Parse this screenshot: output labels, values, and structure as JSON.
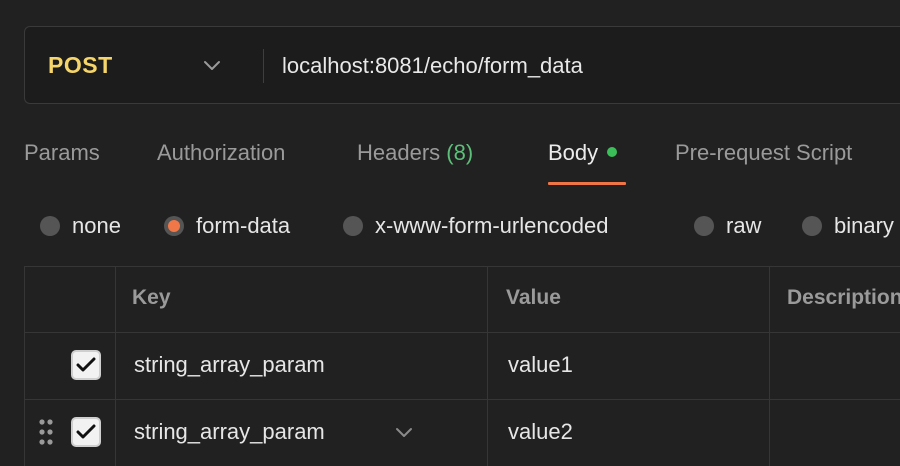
{
  "request": {
    "method": "POST",
    "url": "localhost:8081/echo/form_data"
  },
  "tabs": [
    {
      "label": "Params"
    },
    {
      "label": "Authorization"
    },
    {
      "label": "Headers",
      "count": "(8)"
    },
    {
      "label": "Body",
      "active": true
    },
    {
      "label": "Pre-request Script"
    }
  ],
  "body_types": [
    {
      "label": "none",
      "selected": false
    },
    {
      "label": "form-data",
      "selected": true
    },
    {
      "label": "x-www-form-urlencoded",
      "selected": false
    },
    {
      "label": "raw",
      "selected": false
    },
    {
      "label": "binary",
      "selected": false
    }
  ],
  "table": {
    "headers": {
      "key": "Key",
      "value": "Value",
      "description": "Description"
    },
    "rows": [
      {
        "checked": true,
        "key": "string_array_param",
        "value": "value1",
        "description": ""
      },
      {
        "checked": true,
        "key": "string_array_param",
        "value": "value2",
        "description": ""
      }
    ]
  },
  "colors": {
    "method": "#f5d56a",
    "accent": "#ef7547",
    "status_dot": "#3bbf59",
    "headers_count": "#5dbf79"
  }
}
